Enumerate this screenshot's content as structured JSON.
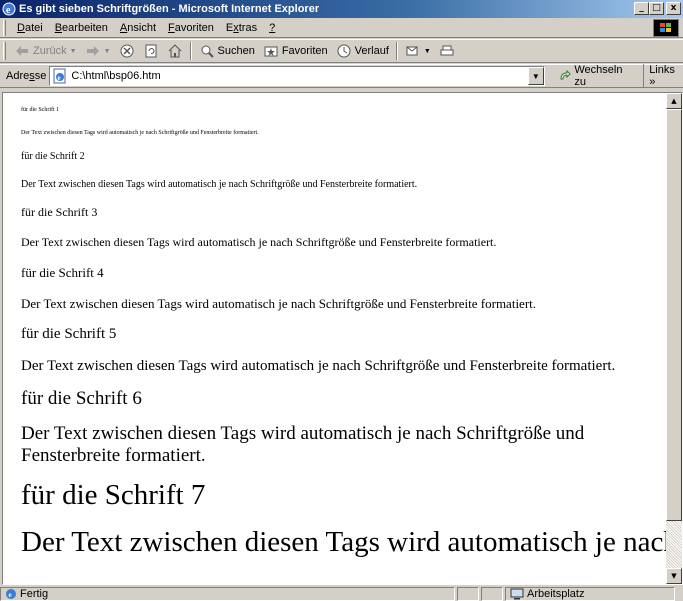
{
  "window": {
    "title": "Es gibt sieben Schriftgrößen - Microsoft Internet Explorer",
    "minimize": "_",
    "maximize": "□",
    "close": "x"
  },
  "menu": {
    "items": [
      {
        "first": "D",
        "rest": "atei"
      },
      {
        "first": "B",
        "rest": "earbeiten"
      },
      {
        "first": "A",
        "rest": "nsicht"
      },
      {
        "first": "F",
        "rest": "avoriten"
      },
      {
        "pre": "E",
        "first": "x",
        "rest": "tras"
      },
      {
        "first": "?",
        "rest": ""
      }
    ]
  },
  "toolbar": {
    "back": "Zurück",
    "search": "Suchen",
    "favorites": "Favoriten",
    "history": "Verlauf"
  },
  "address": {
    "label_pre": "Adre",
    "label_u": "s",
    "label_post": "se",
    "value": "C:\\html\\bsp06.htm",
    "go": "Wechseln zu",
    "links": "Links"
  },
  "content": {
    "lines": [
      {
        "size": "s1",
        "text": "für die Schrift 1"
      },
      {
        "size": "s1",
        "text": "Der Text zwischen diesen Tags wird automatisch je nach Schriftgröße und Fensterbreite formatiert."
      },
      {
        "size": "s2",
        "text": "für die Schrift 2"
      },
      {
        "size": "s2",
        "text": "Der Text zwischen diesen Tags wird automatisch je nach Schriftgröße und Fensterbreite formatiert."
      },
      {
        "size": "s3",
        "text": "für die Schrift 3"
      },
      {
        "size": "s3",
        "text": "Der Text zwischen diesen Tags wird automatisch je nach Schriftgröße und Fensterbreite formatiert."
      },
      {
        "size": "s4",
        "text": "für die Schrift 4"
      },
      {
        "size": "s4",
        "text": "Der Text zwischen diesen Tags wird automatisch je nach Schriftgröße und Fensterbreite formatiert."
      },
      {
        "size": "s5",
        "text": "für die Schrift 5"
      },
      {
        "size": "s5",
        "text": "Der Text zwischen diesen Tags wird automatisch je nach Schriftgröße und Fensterbreite formatiert."
      },
      {
        "size": "s6",
        "text": "für die Schrift 6"
      },
      {
        "size": "s6",
        "text": "Der Text zwischen diesen Tags wird automatisch je nach Schriftgröße und Fensterbreite formatiert."
      },
      {
        "size": "s7",
        "text": "für die Schrift 7"
      },
      {
        "size": "s7",
        "text": "Der Text zwischen diesen Tags wird automatisch je nach"
      }
    ]
  },
  "status": {
    "text": "Fertig",
    "zone": "Arbeitsplatz"
  },
  "icons": {
    "back": "arrow-left-icon",
    "forward": "arrow-right-icon",
    "stop": "stop-icon",
    "refresh": "refresh-icon",
    "home": "home-icon",
    "search": "search-icon",
    "favorites": "favorites-icon",
    "history": "history-icon",
    "mail": "mail-icon",
    "print": "print-icon"
  },
  "colors": {
    "title_start": "#0a246a",
    "title_end": "#a6caf0",
    "chrome": "#d4d0c8"
  }
}
